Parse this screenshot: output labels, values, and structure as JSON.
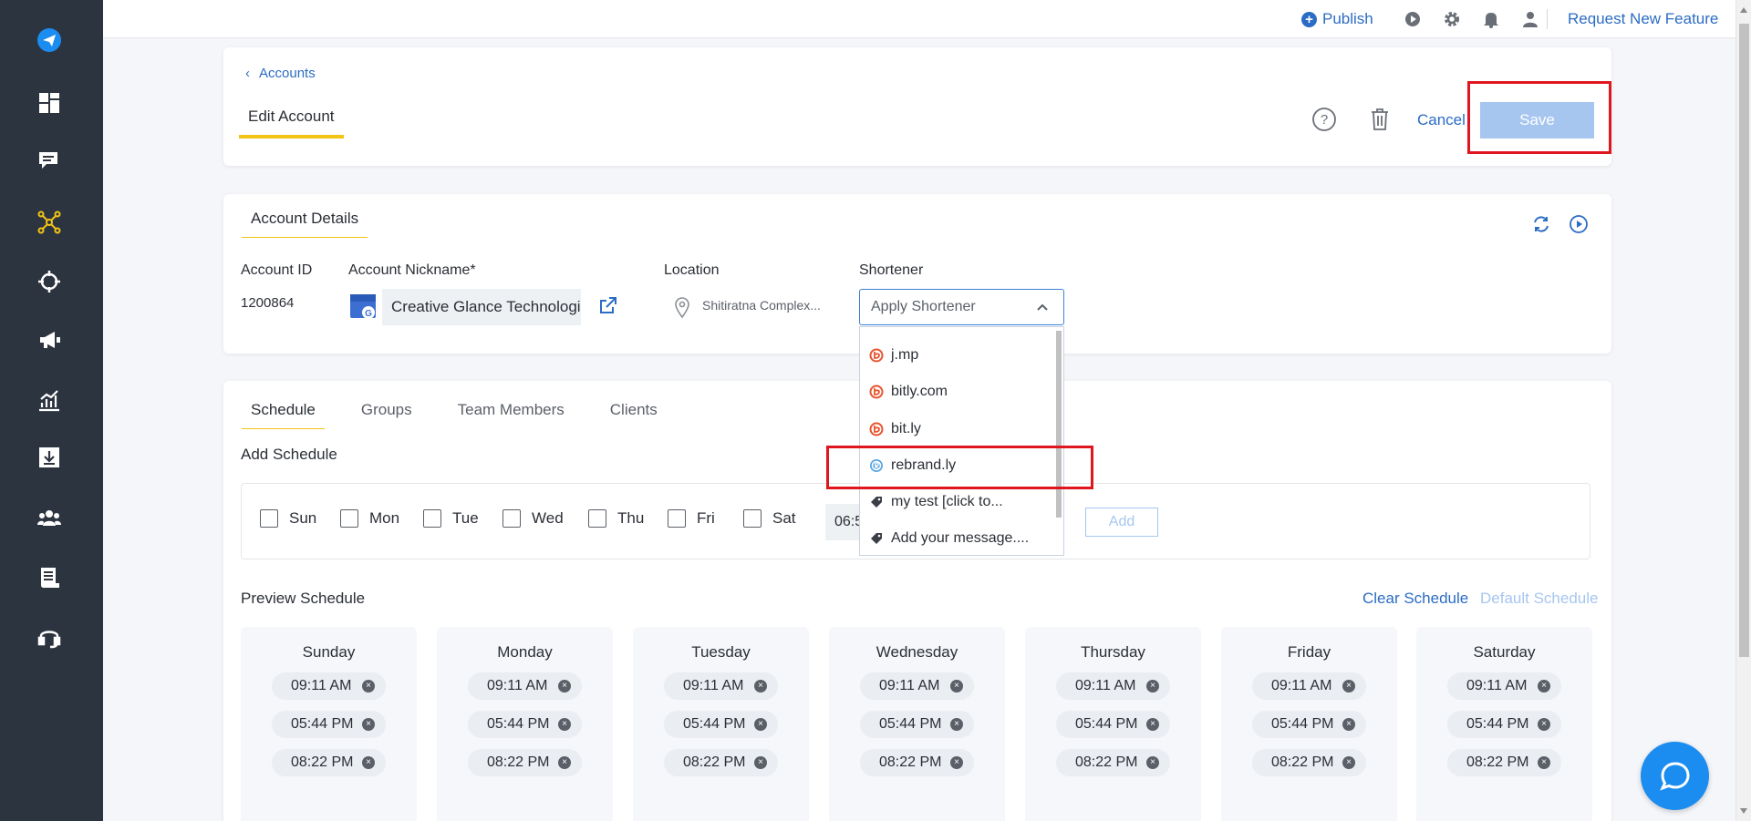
{
  "topbar": {
    "publish_label": "Publish",
    "request_label": "Request New Feature",
    "icons": [
      "play-icon",
      "gear-icon",
      "notification-bell-icon",
      "user-icon"
    ]
  },
  "sidebar": {
    "items": [
      "paper-plane-logo-icon",
      "dashboard-icon",
      "messages-icon",
      "accounts-network-icon",
      "target-icon",
      "megaphone-icon",
      "analytics-icon",
      "download-icon",
      "team-icon",
      "reports-icon",
      "support-headset-icon"
    ],
    "active_color": "#f2c413"
  },
  "header": {
    "back_label": "Accounts",
    "title": "Edit Account",
    "cancel_label": "Cancel",
    "save_label": "Save"
  },
  "details": {
    "tab_label": "Account Details",
    "account_id_label": "Account ID",
    "account_id_value": "1200864",
    "nickname_label": "Account Nickname*",
    "nickname_value": "Creative Glance Technologi",
    "location_label": "Location",
    "location_value": "Shitiratna Complex...",
    "shortener_label": "Shortener",
    "shortener_placeholder": "Apply Shortener"
  },
  "dropdown": {
    "items": [
      {
        "label": "j.mp",
        "icon": "bitly-icon"
      },
      {
        "label": "bitly.com",
        "icon": "bitly-icon"
      },
      {
        "label": "bit.ly",
        "icon": "bitly-icon"
      },
      {
        "label": "rebrand.ly",
        "icon": "rebrandly-icon"
      },
      {
        "label": "my test [click to...",
        "icon": "tag-icon"
      },
      {
        "label": "Add your message....",
        "icon": "tag-icon"
      }
    ]
  },
  "schedule": {
    "tabs": [
      "Schedule",
      "Groups",
      "Team Members",
      "Clients"
    ],
    "add_label": "Add Schedule",
    "days_short": [
      "Sun",
      "Mon",
      "Tue",
      "Wed",
      "Thu",
      "Fri",
      "Sat"
    ],
    "time_value": "06:50",
    "add_button": "Add",
    "preview_label": "Preview Schedule",
    "clear_label": "Clear Schedule",
    "default_label": "Default Schedule",
    "days": [
      {
        "name": "Sunday",
        "times": [
          "09:11 AM",
          "05:44 PM",
          "08:22 PM"
        ]
      },
      {
        "name": "Monday",
        "times": [
          "09:11 AM",
          "05:44 PM",
          "08:22 PM"
        ]
      },
      {
        "name": "Tuesday",
        "times": [
          "09:11 AM",
          "05:44 PM",
          "08:22 PM"
        ]
      },
      {
        "name": "Wednesday",
        "times": [
          "09:11 AM",
          "05:44 PM",
          "08:22 PM"
        ]
      },
      {
        "name": "Thursday",
        "times": [
          "09:11 AM",
          "05:44 PM",
          "08:22 PM"
        ]
      },
      {
        "name": "Friday",
        "times": [
          "09:11 AM",
          "05:44 PM",
          "08:22 PM"
        ]
      },
      {
        "name": "Saturday",
        "times": [
          "09:11 AM",
          "05:44 PM",
          "08:22 PM"
        ]
      }
    ]
  },
  "colors": {
    "accent": "#2b6cc4",
    "highlight": "#e0161f",
    "sidebar": "#2c3440",
    "save_disabled": "#a6c6f0"
  }
}
